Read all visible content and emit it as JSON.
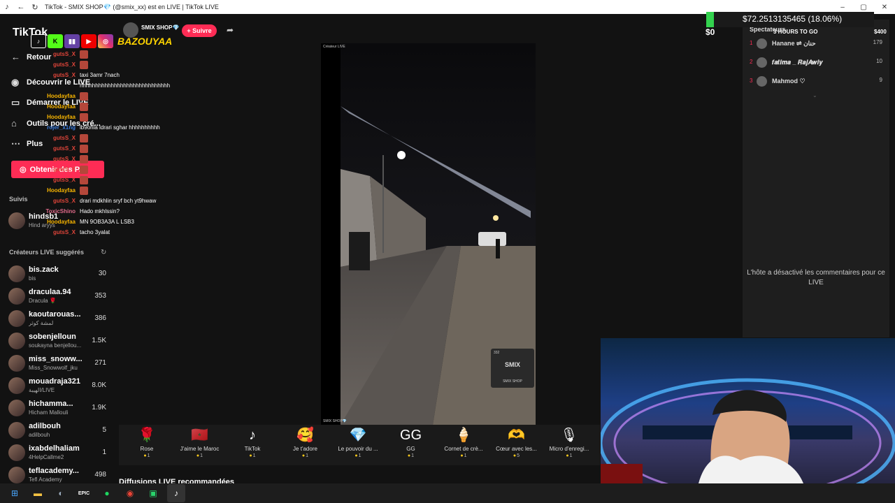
{
  "browser": {
    "title": "TikTok - SMIX SHOP💎 (@smix_xx) est en LIVE | TikTok LIVE"
  },
  "sidebar": {
    "logo": "TikTok",
    "nav": [
      {
        "label": "Retour",
        "icon": "back-arrow-icon"
      },
      {
        "label": "Découvrir le LIVE",
        "icon": "compass-icon"
      },
      {
        "label": "Démarrer le LIVE",
        "icon": "video-camera-icon"
      },
      {
        "label": "Outils pour les cré...",
        "icon": "home-icon"
      },
      {
        "label": "Plus",
        "icon": "ellipsis-icon"
      }
    ],
    "get_coins": "Obtenir des P...",
    "following_title": "Suivis",
    "following": [
      {
        "name": "hindsb1",
        "sub": "Hind aryys"
      }
    ],
    "suggested_title": "Créateurs LIVE suggérés",
    "creators": [
      {
        "name": "bis.zack",
        "sub": "bis",
        "count": "30"
      },
      {
        "name": "draculaa.94",
        "sub": "Dracula 🌹",
        "count": "353"
      },
      {
        "name": "kaoutarouas...",
        "sub": "لمشة كوثر",
        "count": "386"
      },
      {
        "name": "sobenjelloun",
        "sub": "soukayna benjellou...",
        "count": "1.5K"
      },
      {
        "name": "miss_snoww...",
        "sub": "Miss_Snowwolf_jku",
        "count": "271"
      },
      {
        "name": "mouadraja321",
        "sub": "الهيبة/LIVE",
        "count": "8.0K"
      },
      {
        "name": "hichamma...",
        "sub": "Hicham Mallouli",
        "count": "1.9K"
      },
      {
        "name": "adilbouh",
        "sub": "adilbouh",
        "count": "5"
      },
      {
        "name": "ixabdelhaliam",
        "sub": "4HelpCallme2",
        "count": "1"
      },
      {
        "name": "teflacademy...",
        "sub": "Tefl Academy",
        "count": "498"
      }
    ]
  },
  "stream": {
    "host": "SMIX SHOP💎",
    "follow": "+ Suivre",
    "video_tag": "Créateur LIVE",
    "video_watermark": "SMIX SHOP💎",
    "pip_count": "332",
    "pip_name": "SMIX SHOP"
  },
  "gifts": [
    {
      "name": "Rose",
      "price": "1",
      "icon": "🌹"
    },
    {
      "name": "J'aime le Maroc",
      "price": "1",
      "icon": "🇲🇦"
    },
    {
      "name": "TikTok",
      "price": "1",
      "icon": "♪"
    },
    {
      "name": "Je t'adore",
      "price": "1",
      "icon": "🥰"
    },
    {
      "name": "Le pouvoir du ...",
      "price": "1",
      "icon": "💎"
    },
    {
      "name": "GG",
      "price": "1",
      "icon": "GG"
    },
    {
      "name": "Cornet de crè...",
      "price": "1",
      "icon": "🍦"
    },
    {
      "name": "Cœur avec les...",
      "price": "5",
      "icon": "🫶"
    },
    {
      "name": "Micro d'enregi...",
      "price": "1",
      "icon": "🎙"
    }
  ],
  "recommended": "Diffusions LIVE recommandées",
  "right_panel": {
    "spectators": "Spectateurs",
    "ranks": [
      {
        "rank": "1",
        "name": "Hanane ⇌ حنان",
        "count": "179"
      },
      {
        "rank": "2",
        "name": "𝒇𝒂𝒕𝒊𝒎𝒂 _ 𝑹𝒂𝒋𝑨𝒘𝒊𝒚",
        "count": "10"
      },
      {
        "rank": "3",
        "name": "Mahmod ♡",
        "count": "9"
      }
    ],
    "disabled_comments": "L'hôte a désactivé les commentaires pour ce LIVE"
  },
  "overlay": {
    "donation_text": "$72.2513135465 (18.06%)",
    "donation_progress": 0.1806,
    "balance": "$0",
    "goal_label": "3 HOURS TO GO",
    "goal_amount": "$400",
    "brand": "BAZOUYAA",
    "chat": [
      {
        "user": "gutsS_X",
        "text": "",
        "color": "#e0453a"
      },
      {
        "user": "gutsS_X",
        "text": "",
        "color": "#e0453a"
      },
      {
        "user": "gutsS_X",
        "text": "taxi 3amr 7nach",
        "color": "#e0453a"
      },
      {
        "user": "",
        "text": "hhhhhhhhhhhhhhhhhhhhhhhhhhhhh",
        "color": "#e0453a"
      },
      {
        "user": "Hoodayfaa",
        "text": "",
        "color": "#f7b400"
      },
      {
        "user": "Hoodayfaa",
        "text": "",
        "color": "#f7b400"
      },
      {
        "user": "Hoodayfaa",
        "text": "",
        "color": "#f7b400"
      },
      {
        "user": "rojer_x1ng",
        "text": "lb9ohla ldrari sghar hhhhhhhhhh",
        "color": "#3a7ddf"
      },
      {
        "user": "gutsS_X",
        "text": "",
        "color": "#e0453a"
      },
      {
        "user": "gutsS_X",
        "text": "",
        "color": "#e0453a"
      },
      {
        "user": "gutsS_X",
        "text": "",
        "color": "#e0453a"
      },
      {
        "user": "gutsS_X",
        "text": "",
        "color": "#e0453a"
      },
      {
        "user": "gutsS_X",
        "text": "",
        "color": "#e0453a"
      },
      {
        "user": "Hoodayfaa",
        "text": "",
        "color": "#f7b400"
      },
      {
        "user": "gutsS_X",
        "text": "drari mdkhlin sryf bch yt9hwaw",
        "color": "#e0453a"
      },
      {
        "user": "ToxicShino",
        "text": "Hado mkhlssin?",
        "color": "#e06a8a"
      },
      {
        "user": "Hoodayfaa",
        "text": "MN 9OB3A3A L LSB3",
        "color": "#f7b400"
      },
      {
        "user": "gutsS_X",
        "text": "tacho 3yalat",
        "color": "#e0453a"
      }
    ]
  },
  "accent": "#fe2c55"
}
